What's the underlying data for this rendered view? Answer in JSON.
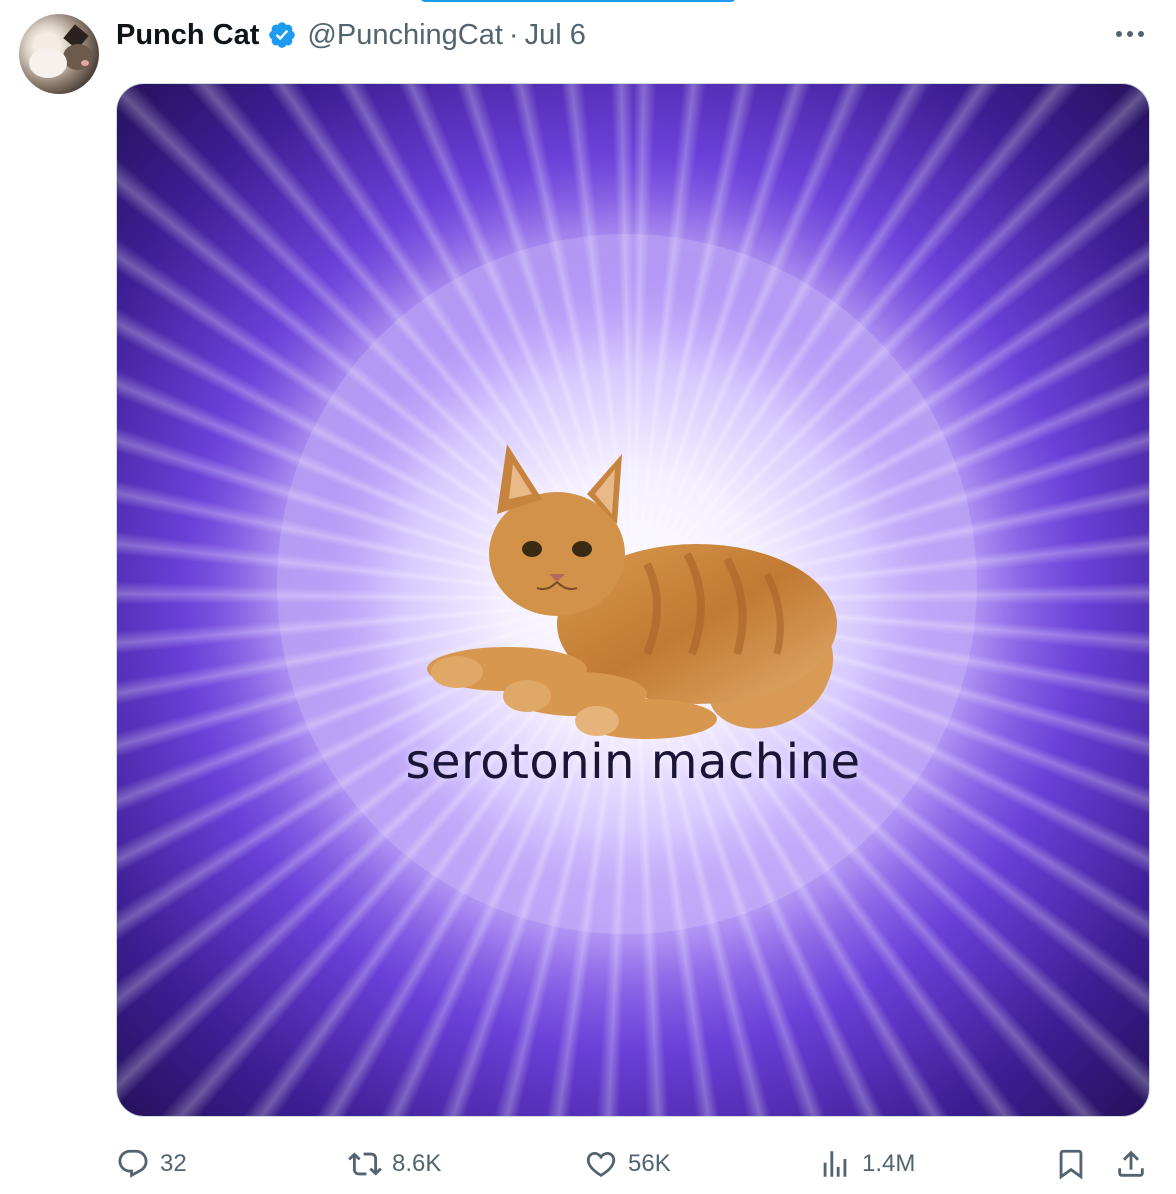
{
  "tweet": {
    "author": {
      "name": "Punch Cat",
      "handle": "@PunchingCat",
      "verified": true,
      "verified_color": "#1d9bf0"
    },
    "separator": "·",
    "date": "Jul 6",
    "more_icon": "more-horizontal-icon",
    "media": {
      "caption": "serotonin machine"
    },
    "actions": {
      "reply_count": "32",
      "retweet_count": "8.6K",
      "like_count": "56K",
      "views_count": "1.4M"
    }
  },
  "colors": {
    "text_primary": "#0f1419",
    "text_secondary": "#536471",
    "accent": "#1d9bf0",
    "border": "#cfd9de"
  }
}
